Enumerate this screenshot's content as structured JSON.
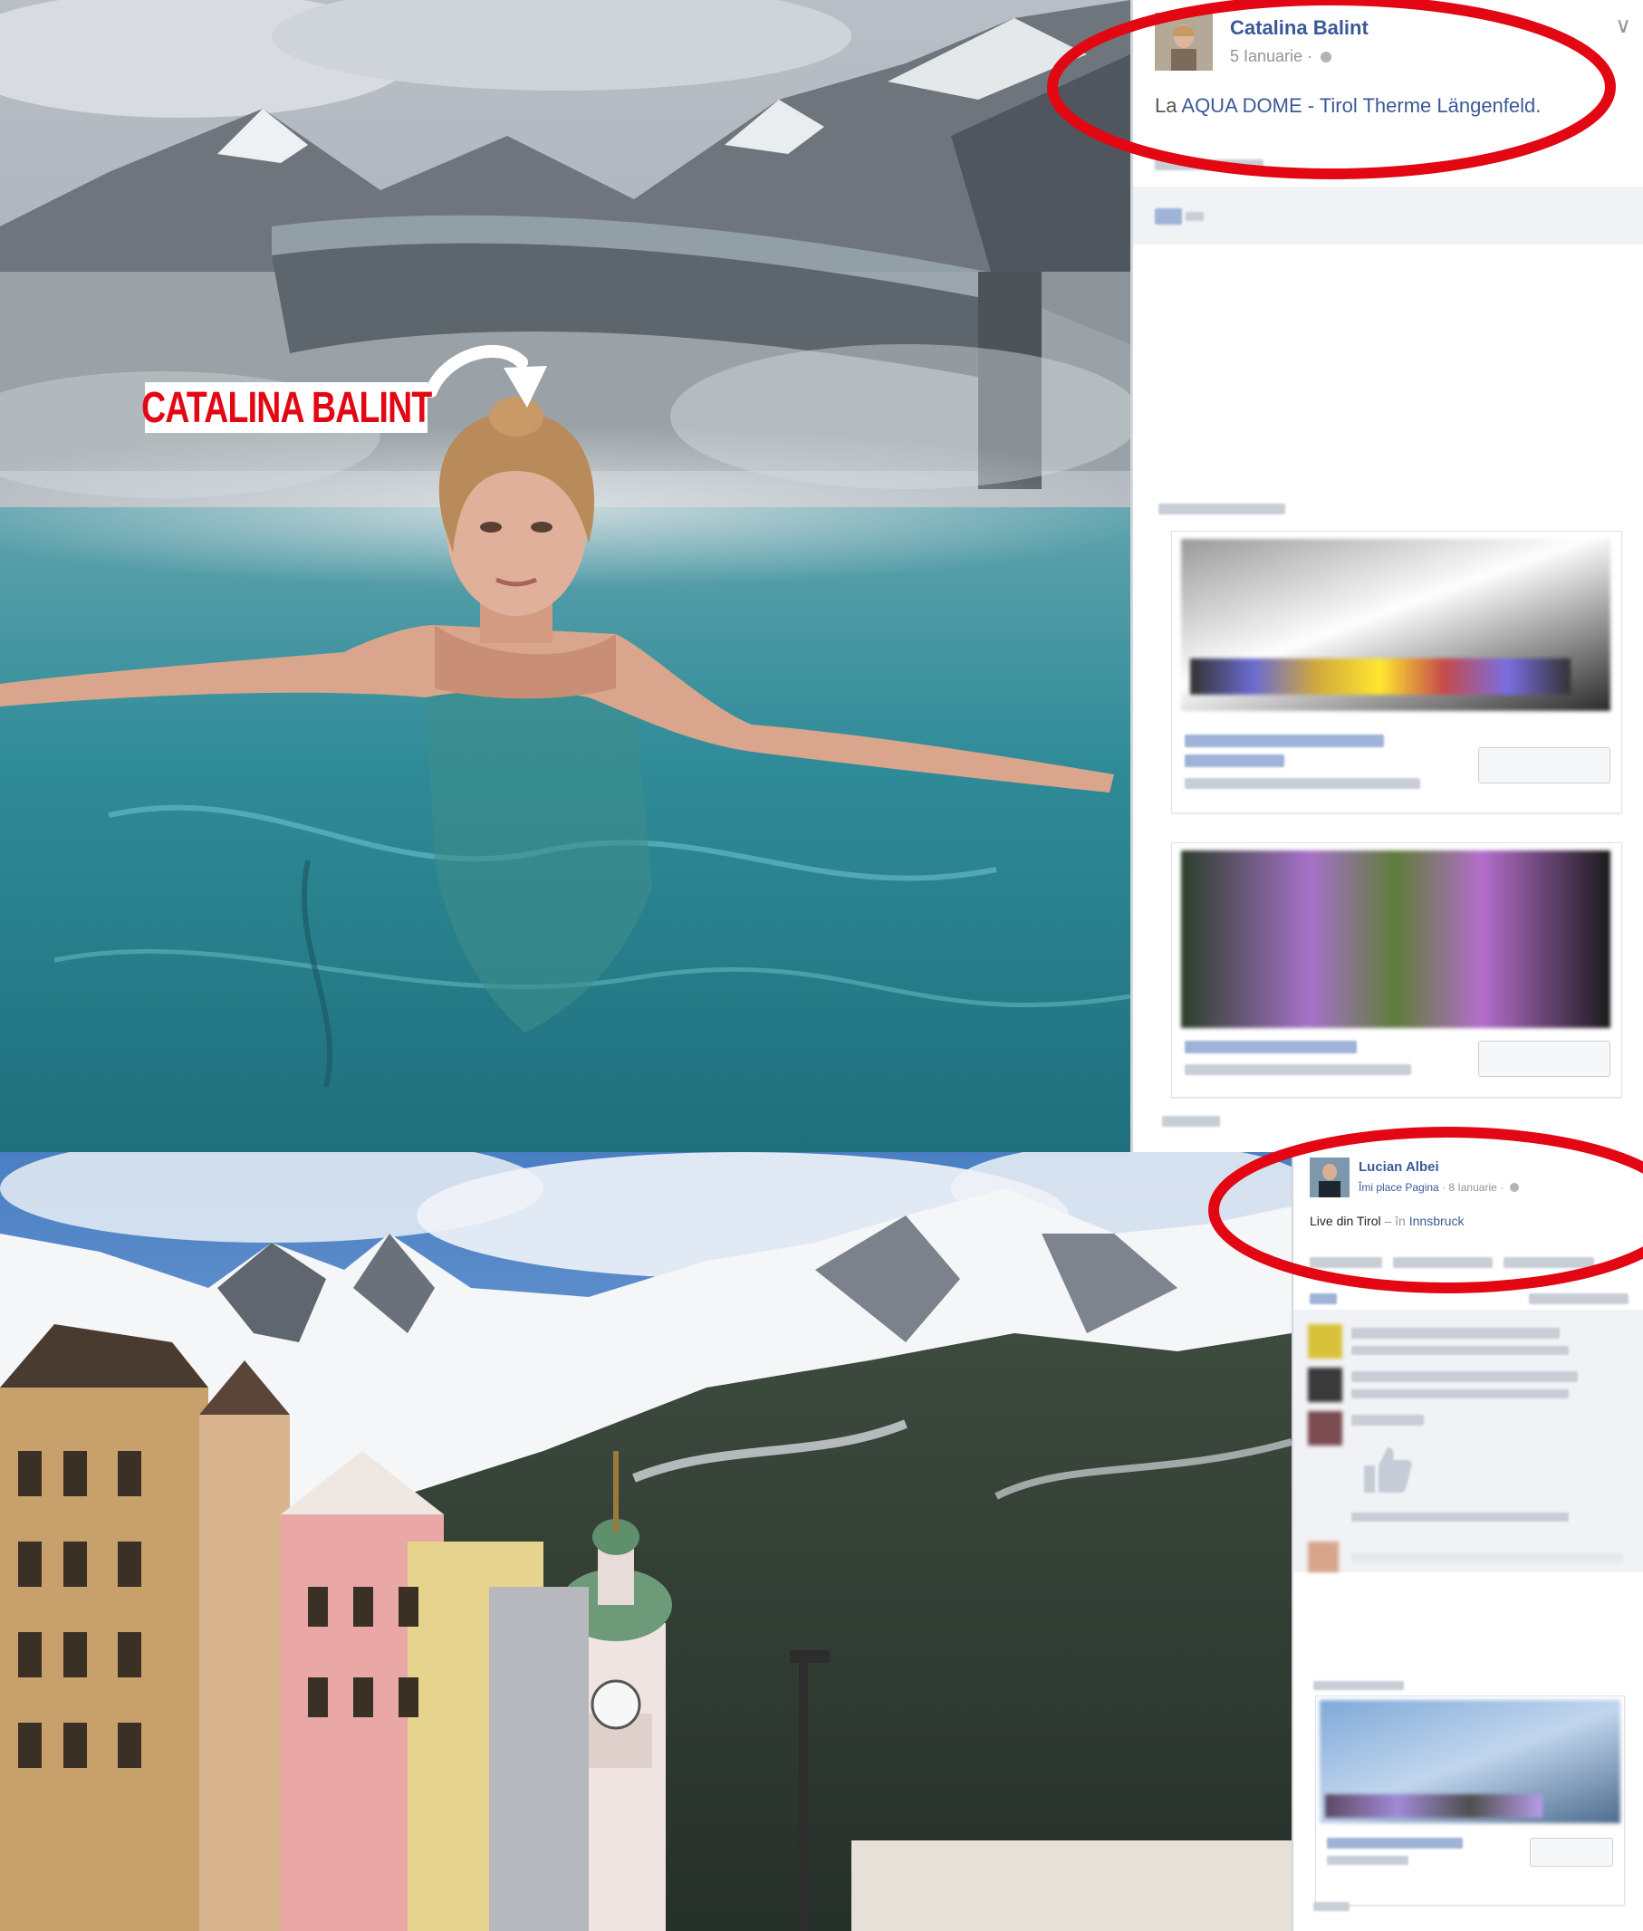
{
  "overlay": {
    "label_text": "CATALINA BALINT"
  },
  "post_top": {
    "author": "Catalina Balint",
    "date": "5 Ianuarie",
    "text_prefix": "La",
    "place_link": "AQUA DOME - Tirol Therme Längenfeld.",
    "chevron": "∨"
  },
  "post_bottom": {
    "author": "Lucian Albei",
    "like_page": "Îmi place Pagina",
    "date": "8 Ianuarie",
    "text": "Live din Tirol",
    "location_prefix": "în",
    "location_link": "Innsbruck"
  },
  "colors": {
    "facebook_blue": "#3b5998",
    "highlight_red": "#e30613",
    "meta_gray": "#90949c"
  },
  "icons": [
    "globe-icon",
    "chevron-down-icon",
    "curved-arrow-icon",
    "thumbs-up-icon"
  ]
}
